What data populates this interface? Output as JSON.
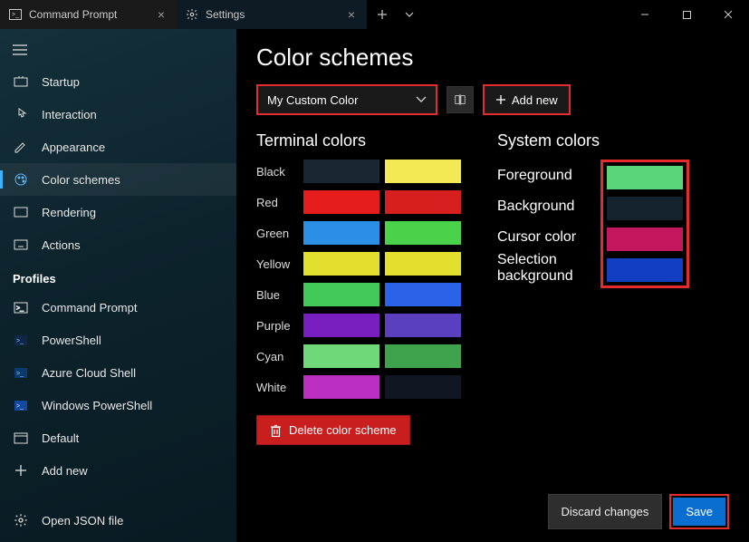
{
  "titlebar": {
    "tabs": [
      {
        "title": "Command Prompt",
        "active": false
      },
      {
        "title": "Settings",
        "active": true
      }
    ]
  },
  "sidebar": {
    "items": [
      {
        "label": "Startup"
      },
      {
        "label": "Interaction"
      },
      {
        "label": "Appearance"
      },
      {
        "label": "Color schemes",
        "selected": true
      },
      {
        "label": "Rendering"
      },
      {
        "label": "Actions"
      }
    ],
    "profiles_header": "Profiles",
    "profiles": [
      {
        "label": "Command Prompt"
      },
      {
        "label": "PowerShell"
      },
      {
        "label": "Azure Cloud Shell"
      },
      {
        "label": "Windows PowerShell"
      },
      {
        "label": "Default"
      },
      {
        "label": "Add new"
      }
    ],
    "footer": {
      "label": "Open JSON file"
    }
  },
  "main": {
    "title": "Color schemes",
    "scheme_select": "My Custom Color",
    "add_new_label": "Add new",
    "terminal_section_title": "Terminal colors",
    "terminal_colors": [
      {
        "name": "Black",
        "a": "#1b2633",
        "b": "#f2ea55"
      },
      {
        "name": "Red",
        "a": "#e71c1c",
        "b": "#d81f1f"
      },
      {
        "name": "Green",
        "a": "#2b8fe6",
        "b": "#4bd24b"
      },
      {
        "name": "Yellow",
        "a": "#e3df2f",
        "b": "#e3df2f"
      },
      {
        "name": "Blue",
        "a": "#43c95a",
        "b": "#2a62e8"
      },
      {
        "name": "Purple",
        "a": "#7a1fbf",
        "b": "#5a3fbf"
      },
      {
        "name": "Cyan",
        "a": "#6fd97a",
        "b": "#3fa34d"
      },
      {
        "name": "White",
        "a": "#bb2fc0",
        "b": "#111722"
      }
    ],
    "system_section_title": "System colors",
    "system_colors": [
      {
        "name": "Foreground",
        "c": "#5cd47a"
      },
      {
        "name": "Background",
        "c": "#14232e"
      },
      {
        "name": "Cursor color",
        "c": "#c4175e"
      },
      {
        "name": "Selection background",
        "c": "#123ec4"
      }
    ],
    "delete_label": "Delete color scheme",
    "footer": {
      "discard": "Discard changes",
      "save": "Save"
    }
  }
}
